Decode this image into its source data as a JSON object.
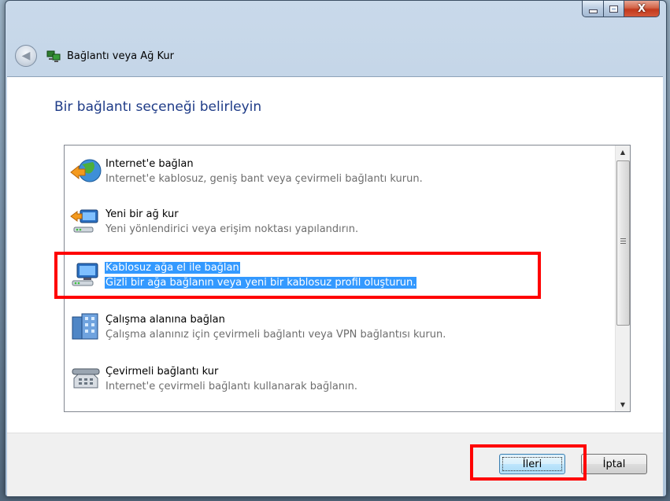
{
  "window": {
    "title": "Bağlantı veya Ağ Kur",
    "close_glyph": "X"
  },
  "page": {
    "heading": "Bir bağlantı seçeneği belirleyin"
  },
  "options": [
    {
      "title": "Internet'e bağlan",
      "description": "Internet'e kablosuz, geniş bant veya çevirmeli bağlantı kurun.",
      "icon": "globe-icon"
    },
    {
      "title": "Yeni bir ağ kur",
      "description": "Yeni yönlendirici veya erişim noktası yapılandırın.",
      "icon": "router-icon"
    },
    {
      "title": "Kablosuz ağa el ile bağlan",
      "description": "Gizli bir ağa bağlanın veya yeni bir kablosuz profil oluşturun.",
      "icon": "wireless-computer-icon",
      "selected": true
    },
    {
      "title": "Çalışma alanına bağlan",
      "description": "Çalışma alanınız için çevirmeli bağlantı veya VPN bağlantısı kurun.",
      "icon": "office-building-icon"
    },
    {
      "title": "Çevirmeli bağlantı kur",
      "description": "Internet'e çevirmeli bağlantı kullanarak bağlanın.",
      "icon": "telephone-icon"
    }
  ],
  "buttons": {
    "next": "İleri",
    "cancel": "İptal"
  },
  "colors": {
    "heading": "#1e3b87",
    "selection": "#3399ff",
    "annotation": "#ff0000"
  }
}
